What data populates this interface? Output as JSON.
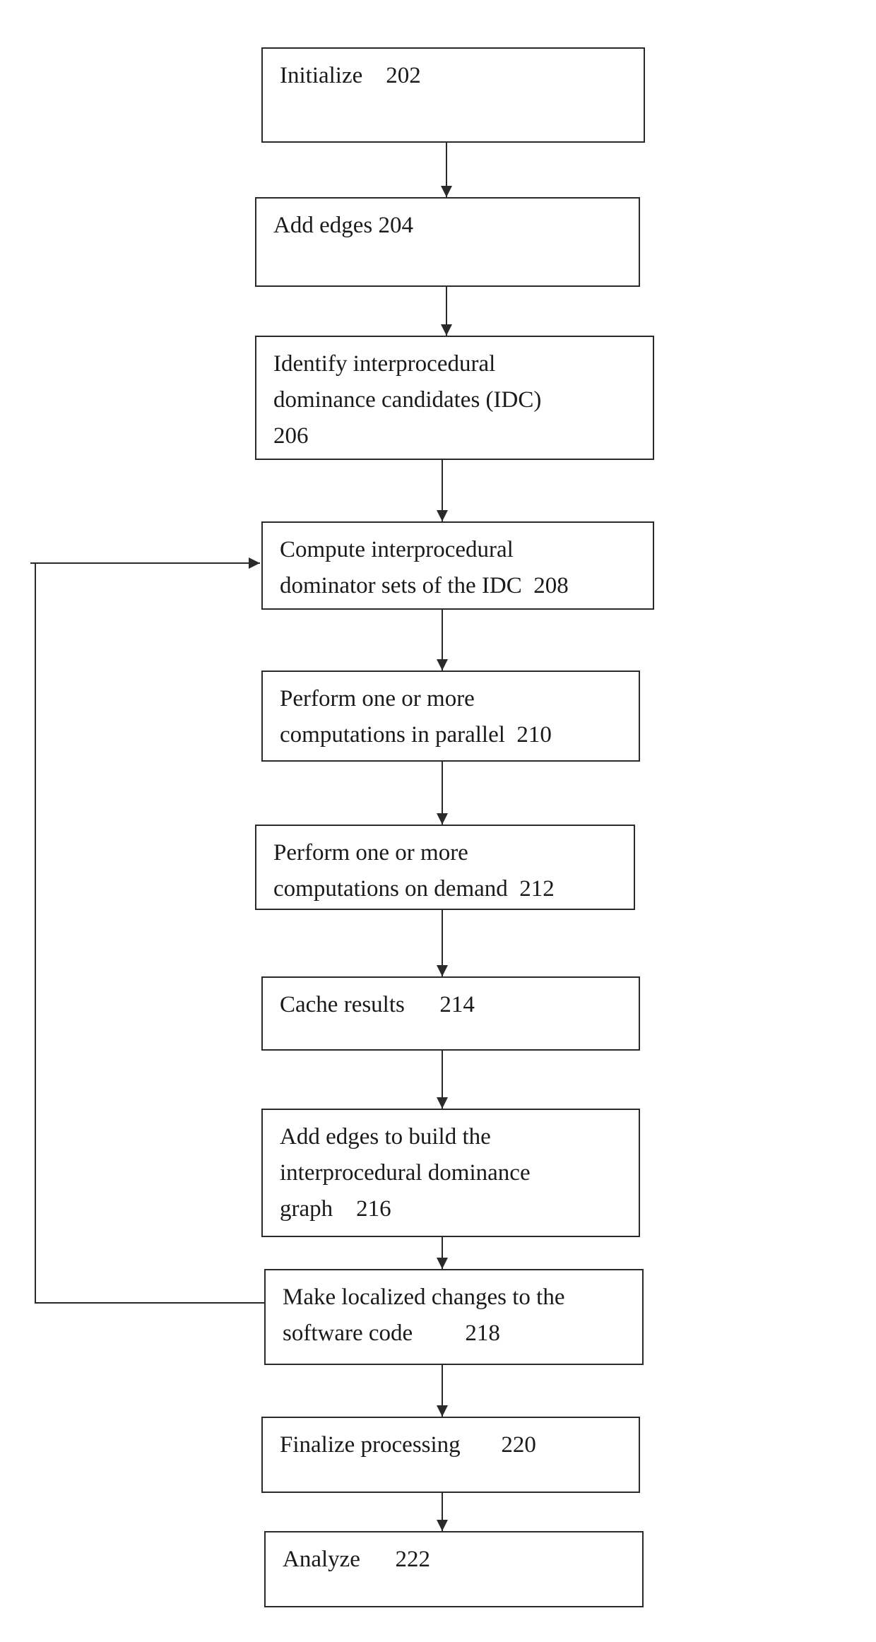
{
  "diagram": {
    "type": "flowchart",
    "steps": [
      {
        "id": "202",
        "lines": [
          "Initialize    202"
        ]
      },
      {
        "id": "204",
        "lines": [
          "Add edges 204"
        ]
      },
      {
        "id": "206",
        "lines": [
          "Identify interprocedural",
          "dominance candidates (IDC)",
          "206"
        ]
      },
      {
        "id": "208",
        "lines": [
          "Compute interprocedural",
          "dominator sets of the IDC  208"
        ]
      },
      {
        "id": "210",
        "lines": [
          "Perform one or more",
          "computations in parallel  210"
        ]
      },
      {
        "id": "212",
        "lines": [
          "Perform one or more",
          "computations on demand  212"
        ]
      },
      {
        "id": "214",
        "lines": [
          "Cache results      214"
        ]
      },
      {
        "id": "216",
        "lines": [
          "Add edges to build the",
          "interprocedural dominance",
          "graph    216"
        ]
      },
      {
        "id": "218",
        "lines": [
          "Make localized changes to the",
          "software code         218"
        ]
      },
      {
        "id": "220",
        "lines": [
          "Finalize processing       220"
        ]
      },
      {
        "id": "222",
        "lines": [
          "Analyze      222"
        ]
      }
    ],
    "edges": [
      {
        "from": "202",
        "to": "204"
      },
      {
        "from": "204",
        "to": "206"
      },
      {
        "from": "206",
        "to": "208"
      },
      {
        "from": "208",
        "to": "210"
      },
      {
        "from": "210",
        "to": "212"
      },
      {
        "from": "212",
        "to": "214"
      },
      {
        "from": "214",
        "to": "216"
      },
      {
        "from": "216",
        "to": "218"
      },
      {
        "from": "218",
        "to": "220"
      },
      {
        "from": "220",
        "to": "222"
      },
      {
        "from": "218",
        "to": "208",
        "kind": "feedback-loop"
      }
    ],
    "colors": {
      "stroke": "#2a2a2a",
      "background": "#ffffff",
      "text": "#1a1a1a"
    }
  }
}
